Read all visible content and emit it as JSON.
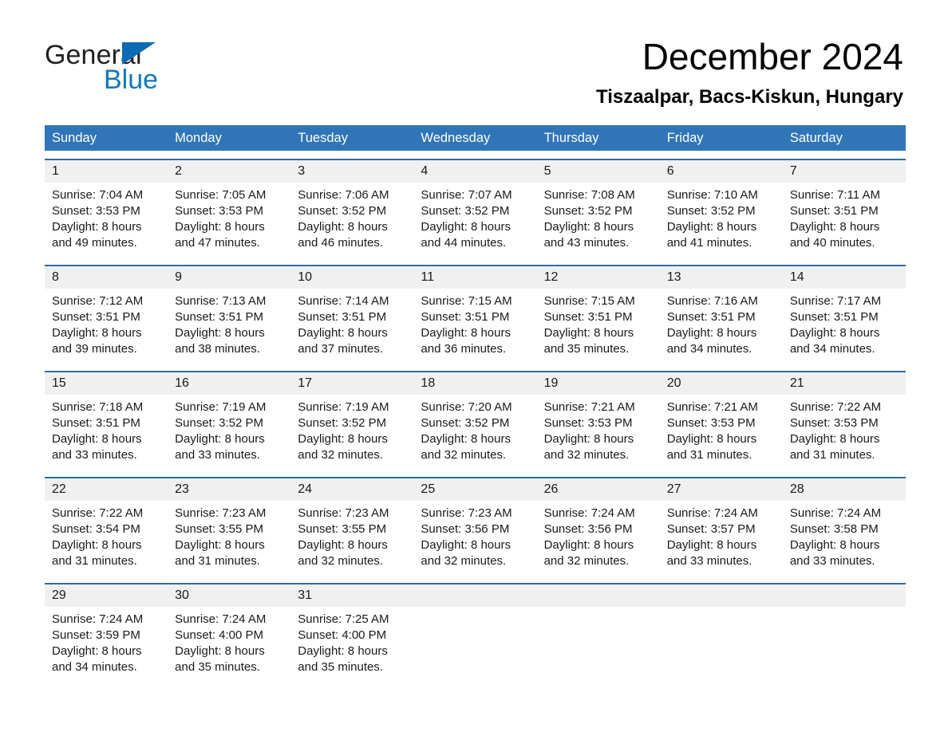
{
  "brand": {
    "name_dark": "General",
    "name_blue": "Blue",
    "logo_color": "#0b6cb4",
    "blue_text_color": "#1278be"
  },
  "header": {
    "title": "December 2024",
    "subtitle": "Tiszaalpar, Bacs-Kiskun, Hungary"
  },
  "theme": {
    "header_blue": "#3075b8",
    "row_rule_blue": "#2d6da6",
    "daynum_strip": "#f0f0f0",
    "text": "#1a1a1a"
  },
  "calendar": {
    "weekdays": [
      "Sunday",
      "Monday",
      "Tuesday",
      "Wednesday",
      "Thursday",
      "Friday",
      "Saturday"
    ],
    "weeks": [
      {
        "daynums": [
          "1",
          "2",
          "3",
          "4",
          "5",
          "6",
          "7"
        ],
        "cells": [
          {
            "l1": "Sunrise: 7:04 AM",
            "l2": "Sunset: 3:53 PM",
            "l3": "Daylight: 8 hours",
            "l4": "and 49 minutes."
          },
          {
            "l1": "Sunrise: 7:05 AM",
            "l2": "Sunset: 3:53 PM",
            "l3": "Daylight: 8 hours",
            "l4": "and 47 minutes."
          },
          {
            "l1": "Sunrise: 7:06 AM",
            "l2": "Sunset: 3:52 PM",
            "l3": "Daylight: 8 hours",
            "l4": "and 46 minutes."
          },
          {
            "l1": "Sunrise: 7:07 AM",
            "l2": "Sunset: 3:52 PM",
            "l3": "Daylight: 8 hours",
            "l4": "and 44 minutes."
          },
          {
            "l1": "Sunrise: 7:08 AM",
            "l2": "Sunset: 3:52 PM",
            "l3": "Daylight: 8 hours",
            "l4": "and 43 minutes."
          },
          {
            "l1": "Sunrise: 7:10 AM",
            "l2": "Sunset: 3:52 PM",
            "l3": "Daylight: 8 hours",
            "l4": "and 41 minutes."
          },
          {
            "l1": "Sunrise: 7:11 AM",
            "l2": "Sunset: 3:51 PM",
            "l3": "Daylight: 8 hours",
            "l4": "and 40 minutes."
          }
        ]
      },
      {
        "daynums": [
          "8",
          "9",
          "10",
          "11",
          "12",
          "13",
          "14"
        ],
        "cells": [
          {
            "l1": "Sunrise: 7:12 AM",
            "l2": "Sunset: 3:51 PM",
            "l3": "Daylight: 8 hours",
            "l4": "and 39 minutes."
          },
          {
            "l1": "Sunrise: 7:13 AM",
            "l2": "Sunset: 3:51 PM",
            "l3": "Daylight: 8 hours",
            "l4": "and 38 minutes."
          },
          {
            "l1": "Sunrise: 7:14 AM",
            "l2": "Sunset: 3:51 PM",
            "l3": "Daylight: 8 hours",
            "l4": "and 37 minutes."
          },
          {
            "l1": "Sunrise: 7:15 AM",
            "l2": "Sunset: 3:51 PM",
            "l3": "Daylight: 8 hours",
            "l4": "and 36 minutes."
          },
          {
            "l1": "Sunrise: 7:15 AM",
            "l2": "Sunset: 3:51 PM",
            "l3": "Daylight: 8 hours",
            "l4": "and 35 minutes."
          },
          {
            "l1": "Sunrise: 7:16 AM",
            "l2": "Sunset: 3:51 PM",
            "l3": "Daylight: 8 hours",
            "l4": "and 34 minutes."
          },
          {
            "l1": "Sunrise: 7:17 AM",
            "l2": "Sunset: 3:51 PM",
            "l3": "Daylight: 8 hours",
            "l4": "and 34 minutes."
          }
        ]
      },
      {
        "daynums": [
          "15",
          "16",
          "17",
          "18",
          "19",
          "20",
          "21"
        ],
        "cells": [
          {
            "l1": "Sunrise: 7:18 AM",
            "l2": "Sunset: 3:51 PM",
            "l3": "Daylight: 8 hours",
            "l4": "and 33 minutes."
          },
          {
            "l1": "Sunrise: 7:19 AM",
            "l2": "Sunset: 3:52 PM",
            "l3": "Daylight: 8 hours",
            "l4": "and 33 minutes."
          },
          {
            "l1": "Sunrise: 7:19 AM",
            "l2": "Sunset: 3:52 PM",
            "l3": "Daylight: 8 hours",
            "l4": "and 32 minutes."
          },
          {
            "l1": "Sunrise: 7:20 AM",
            "l2": "Sunset: 3:52 PM",
            "l3": "Daylight: 8 hours",
            "l4": "and 32 minutes."
          },
          {
            "l1": "Sunrise: 7:21 AM",
            "l2": "Sunset: 3:53 PM",
            "l3": "Daylight: 8 hours",
            "l4": "and 32 minutes."
          },
          {
            "l1": "Sunrise: 7:21 AM",
            "l2": "Sunset: 3:53 PM",
            "l3": "Daylight: 8 hours",
            "l4": "and 31 minutes."
          },
          {
            "l1": "Sunrise: 7:22 AM",
            "l2": "Sunset: 3:53 PM",
            "l3": "Daylight: 8 hours",
            "l4": "and 31 minutes."
          }
        ]
      },
      {
        "daynums": [
          "22",
          "23",
          "24",
          "25",
          "26",
          "27",
          "28"
        ],
        "cells": [
          {
            "l1": "Sunrise: 7:22 AM",
            "l2": "Sunset: 3:54 PM",
            "l3": "Daylight: 8 hours",
            "l4": "and 31 minutes."
          },
          {
            "l1": "Sunrise: 7:23 AM",
            "l2": "Sunset: 3:55 PM",
            "l3": "Daylight: 8 hours",
            "l4": "and 31 minutes."
          },
          {
            "l1": "Sunrise: 7:23 AM",
            "l2": "Sunset: 3:55 PM",
            "l3": "Daylight: 8 hours",
            "l4": "and 32 minutes."
          },
          {
            "l1": "Sunrise: 7:23 AM",
            "l2": "Sunset: 3:56 PM",
            "l3": "Daylight: 8 hours",
            "l4": "and 32 minutes."
          },
          {
            "l1": "Sunrise: 7:24 AM",
            "l2": "Sunset: 3:56 PM",
            "l3": "Daylight: 8 hours",
            "l4": "and 32 minutes."
          },
          {
            "l1": "Sunrise: 7:24 AM",
            "l2": "Sunset: 3:57 PM",
            "l3": "Daylight: 8 hours",
            "l4": "and 33 minutes."
          },
          {
            "l1": "Sunrise: 7:24 AM",
            "l2": "Sunset: 3:58 PM",
            "l3": "Daylight: 8 hours",
            "l4": "and 33 minutes."
          }
        ]
      },
      {
        "daynums": [
          "29",
          "30",
          "31",
          "",
          "",
          "",
          ""
        ],
        "cells": [
          {
            "l1": "Sunrise: 7:24 AM",
            "l2": "Sunset: 3:59 PM",
            "l3": "Daylight: 8 hours",
            "l4": "and 34 minutes."
          },
          {
            "l1": "Sunrise: 7:24 AM",
            "l2": "Sunset: 4:00 PM",
            "l3": "Daylight: 8 hours",
            "l4": "and 35 minutes."
          },
          {
            "l1": "Sunrise: 7:25 AM",
            "l2": "Sunset: 4:00 PM",
            "l3": "Daylight: 8 hours",
            "l4": "and 35 minutes."
          },
          {
            "l1": "",
            "l2": "",
            "l3": "",
            "l4": ""
          },
          {
            "l1": "",
            "l2": "",
            "l3": "",
            "l4": ""
          },
          {
            "l1": "",
            "l2": "",
            "l3": "",
            "l4": ""
          },
          {
            "l1": "",
            "l2": "",
            "l3": "",
            "l4": ""
          }
        ]
      }
    ]
  }
}
